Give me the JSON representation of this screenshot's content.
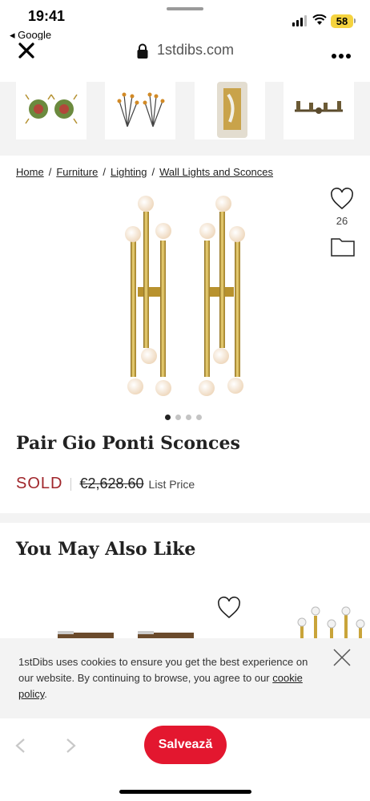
{
  "status_bar": {
    "time": "19:41",
    "back_app": "◂ Google",
    "battery": "58"
  },
  "browser": {
    "url": "1stdibs.com",
    "icons": [
      "close-icon",
      "lock-icon",
      "more-icon"
    ]
  },
  "thumbnails": [
    "pair-of-green-sconces",
    "floral-sconces",
    "ceramic-panel-sconce",
    "candelabra-wall-light"
  ],
  "breadcrumb": {
    "items": [
      "Home",
      "Furniture",
      "Lighting",
      "Wall Lights and Sconces"
    ],
    "separator": "/"
  },
  "product": {
    "favorite_count": "26",
    "title": "Pair Gio Ponti Sconces",
    "status": "SOLD",
    "old_price": "€2,628.60",
    "price_note": "List Price",
    "image_count": 4,
    "active_image": 1
  },
  "recommendations": {
    "title": "You May Also Like"
  },
  "cookie": {
    "text": "1stDibs uses cookies to ensure you get the best experience on our website. By continuing to browse, you agree to our ",
    "link": "cookie policy",
    "end": "."
  },
  "bottom": {
    "save_label": "Salvează"
  },
  "colors": {
    "accent_red": "#e3172f",
    "sold_red": "#a0262b",
    "brass": "#c9a43a"
  }
}
